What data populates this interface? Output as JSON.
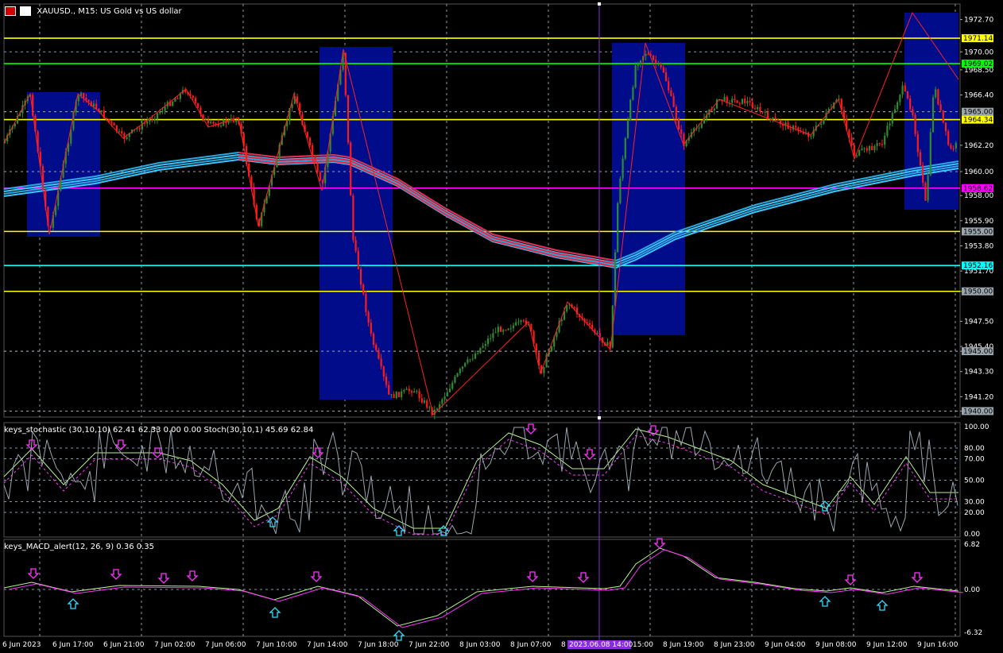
{
  "title": {
    "symbol_line": "XAUUSD., M15: US Gold vs US dollar"
  },
  "price_axis": {
    "ticks": [
      "1972.70",
      "1970.00",
      "1968.50",
      "1966.40",
      "1962.20",
      "1960.00",
      "1958.00",
      "1955.90",
      "1953.80",
      "1951.70",
      "1950.00",
      "1947.50",
      "1945.40",
      "1945.00",
      "1943.30",
      "1941.20",
      "1940.00"
    ],
    "tags": [
      {
        "text": "1971.14",
        "color": "#ffff00"
      },
      {
        "text": "1969.02",
        "color": "#00ff00"
      },
      {
        "text": "1965.00",
        "color": "#9aa5ad"
      },
      {
        "text": "1964.34",
        "color": "#ffff00"
      },
      {
        "text": "1958.62",
        "color": "#ff00ff"
      },
      {
        "text": "1955.00",
        "color": "#9aa5ad"
      },
      {
        "text": "1952.16",
        "color": "#00ffff"
      },
      {
        "text": "1950.00",
        "color": "#9aa5ad"
      },
      {
        "text": "1945.00",
        "color": "#9aa5ad"
      },
      {
        "text": "1940.00",
        "color": "#9aa5ad"
      }
    ]
  },
  "levels": [
    {
      "price": 1971.14,
      "color": "#ffff00",
      "style": "solid"
    },
    {
      "price": 1969.02,
      "color": "#00ff00",
      "style": "solid"
    },
    {
      "price": 1965.0,
      "color": "#9aa5ad",
      "style": "dotted"
    },
    {
      "price": 1964.34,
      "color": "#ffff00",
      "style": "solid"
    },
    {
      "price": 1960.0,
      "color": "#9aa5ad",
      "style": "dotted"
    },
    {
      "price": 1958.62,
      "color": "#ff00ff",
      "style": "solid"
    },
    {
      "price": 1955.0,
      "color": "#ffff00",
      "style": "solid"
    },
    {
      "price": 1952.16,
      "color": "#00ffff",
      "style": "solid"
    },
    {
      "price": 1950.0,
      "color": "#ffff00",
      "style": "solid"
    },
    {
      "price": 1945.0,
      "color": "#9aa5ad",
      "style": "dotted"
    },
    {
      "price": 1940.0,
      "color": "#9aa5ad",
      "style": "dotted"
    }
  ],
  "stoch_panel": {
    "label": "keys_stochastic (30,10,10) 62.41 62.33 0.00 0.00 Stoch(30,10,1) 45.69 62.84",
    "ticks": [
      "100.00",
      "80.00",
      "70.00",
      "50.00",
      "30.00",
      "20.00",
      "0.00"
    ]
  },
  "macd_panel": {
    "label": "keys_MACD_alert(12, 26, 9) 0.36 0.35",
    "ticks": [
      "6.82",
      "0.00",
      "-6.32"
    ]
  },
  "time_axis": {
    "labels": [
      "6 Jun 2023",
      "6 Jun 17:00",
      "6 Jun 21:00",
      "7 Jun 02:00",
      "7 Jun 06:00",
      "7 Jun 10:00",
      "7 Jun 14:00",
      "7 Jun 18:00",
      "7 Jun 22:00",
      "8 Jun 03:00",
      "8 Jun 07:00",
      "8",
      "15:00",
      "8 Jun 19:00",
      "8 Jun 23:00",
      "9 Jun 04:00",
      "9 Jun 08:00",
      "9 Jun 12:00",
      "9 Jun 16:00"
    ],
    "crosshair_label": "2023.06.08 14:00"
  },
  "colors": {
    "background": "#000000",
    "bull_candle": "#2e8b2e",
    "bear_candle": "#ff1a1a",
    "zone": "#000c8a",
    "crosshair": "#8a2be2",
    "ma_blue": "#38c8ff",
    "ma_red": "#e8284a",
    "zigzag": "#ff2020"
  }
}
